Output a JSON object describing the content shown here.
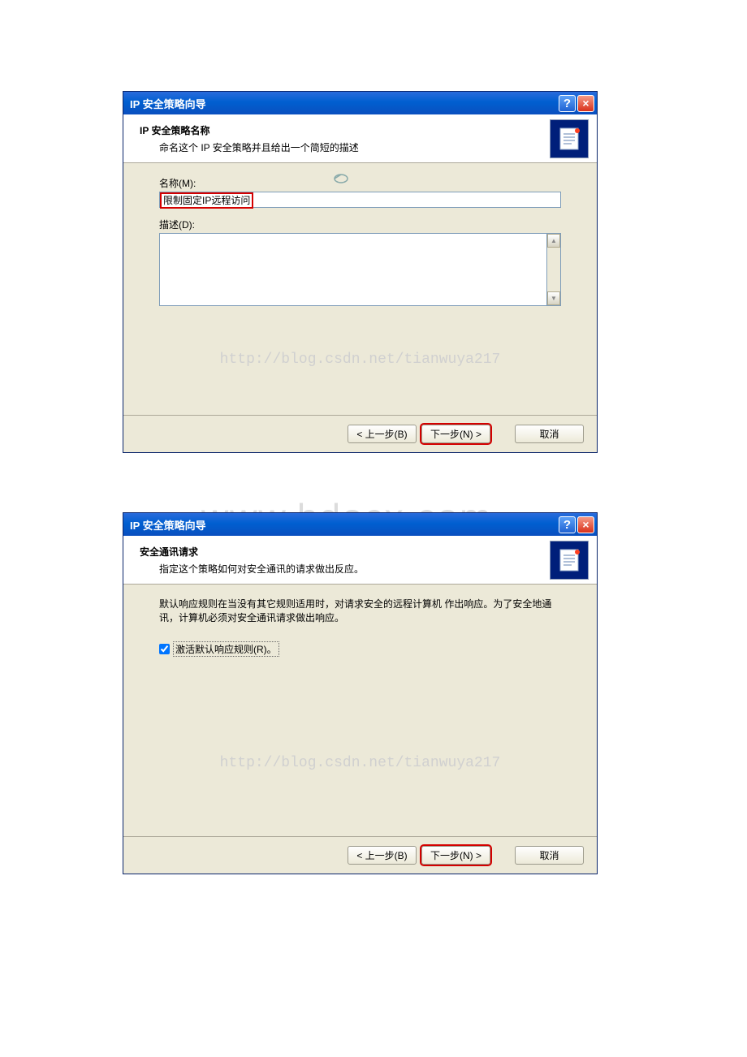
{
  "watermark_big": "www.bdocx.com",
  "watermark_url": "http://blog.csdn.net/tianwuya217",
  "dialog1": {
    "title": "IP 安全策略向导",
    "header_title": "IP 安全策略名称",
    "header_sub": "命名这个 IP 安全策略并且给出一个简短的描述",
    "name_label": "名称(M):",
    "name_value": "限制固定IP远程访问",
    "desc_label": "描述(D):",
    "desc_value": "",
    "back": "< 上一步(B)",
    "next": "下一步(N) >",
    "cancel": "取消"
  },
  "dialog2": {
    "title": "IP 安全策略向导",
    "header_title": "安全通讯请求",
    "header_sub": "指定这个策略如何对安全通讯的请求做出反应。",
    "body_text": "默认响应规则在当没有其它规则适用时，对请求安全的远程计算机 作出响应。为了安全地通讯，计算机必须对安全通讯请求做出响应。",
    "checkbox_label": "激活默认响应规则(R)。",
    "back": "< 上一步(B)",
    "next": "下一步(N) >",
    "cancel": "取消"
  }
}
